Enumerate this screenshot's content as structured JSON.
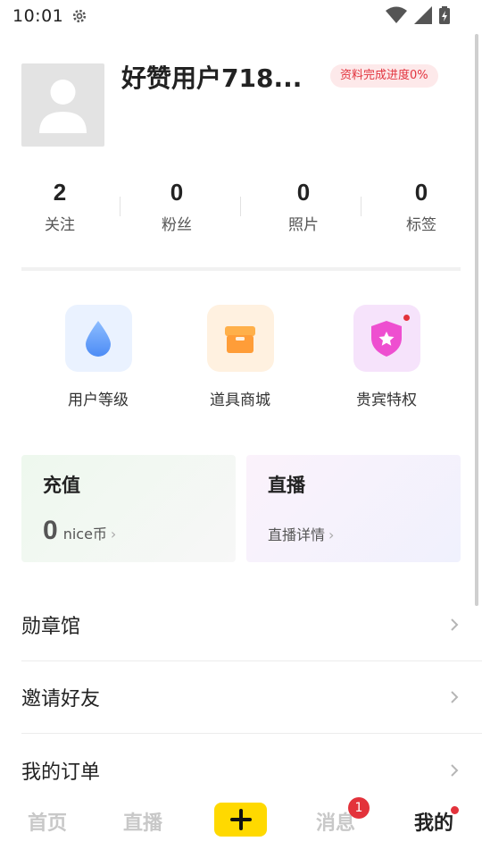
{
  "status_bar": {
    "time": "10:01"
  },
  "profile": {
    "username": "好赞用户718...",
    "progress_badge": "资料完成进度0%"
  },
  "stats": [
    {
      "value": "2",
      "label": "关注"
    },
    {
      "value": "0",
      "label": "粉丝"
    },
    {
      "value": "0",
      "label": "照片"
    },
    {
      "value": "0",
      "label": "标签"
    }
  ],
  "features": [
    {
      "label": "用户等级",
      "icon": "water-drop-icon",
      "bg": "#eaf2ff",
      "color": "#5b9cff"
    },
    {
      "label": "道具商城",
      "icon": "shop-box-icon",
      "bg": "#fff1e0",
      "color": "#ff9f43"
    },
    {
      "label": "贵宾特权",
      "icon": "vip-shield-icon",
      "bg": "#f6e3fb",
      "color": "#ee4fd0"
    }
  ],
  "cards": {
    "recharge": {
      "title": "充值",
      "amount": "0",
      "unit": "nice币"
    },
    "live": {
      "title": "直播",
      "link": "直播详情"
    }
  },
  "menu": [
    {
      "label": "勋章馆"
    },
    {
      "label": "邀请好友"
    },
    {
      "label": "我的订单"
    }
  ],
  "bottom_nav": {
    "home": "首页",
    "live": "直播",
    "messages": "消息",
    "messages_badge": "1",
    "me": "我的"
  },
  "colors": {
    "accent_yellow": "#ffd900",
    "badge_red": "#e3323b"
  }
}
